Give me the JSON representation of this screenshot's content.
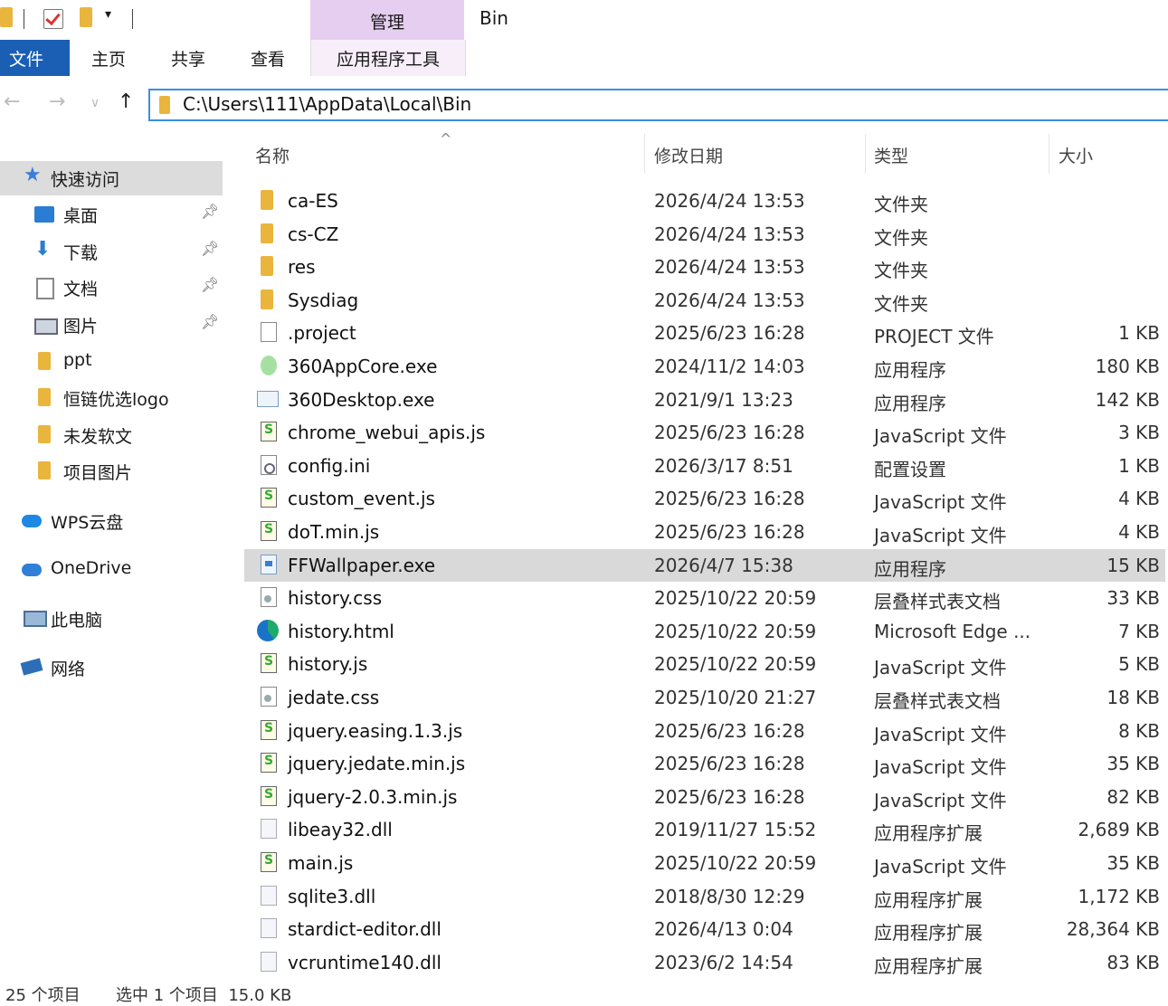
{
  "window": {
    "title": "Bin",
    "context_tab_group": "管理",
    "context_tab": "应用程序工具"
  },
  "ribbon": {
    "tabs": [
      "文件",
      "主页",
      "共享",
      "查看"
    ]
  },
  "address": {
    "path": "C:\\Users\\111\\AppData\\Local\\Bin"
  },
  "sidebar": {
    "quick_access": "快速访问",
    "items": [
      {
        "label": "桌面",
        "icon": "desktop-icon",
        "pinned": true
      },
      {
        "label": "下载",
        "icon": "download-icon",
        "pinned": true
      },
      {
        "label": "文档",
        "icon": "document-icon",
        "pinned": true
      },
      {
        "label": "图片",
        "icon": "picture-icon",
        "pinned": true
      },
      {
        "label": "ppt",
        "icon": "folder-icon",
        "pinned": false
      },
      {
        "label": "恒链优选logo",
        "icon": "folder-icon",
        "pinned": false
      },
      {
        "label": "未发软文",
        "icon": "folder-icon",
        "pinned": false
      },
      {
        "label": "项目图片",
        "icon": "folder-icon",
        "pinned": false
      }
    ],
    "locations": [
      {
        "label": "WPS云盘",
        "icon": "wps-cloud-icon"
      },
      {
        "label": "OneDrive",
        "icon": "onedrive-icon"
      },
      {
        "label": "此电脑",
        "icon": "this-pc-icon"
      },
      {
        "label": "网络",
        "icon": "network-icon"
      }
    ]
  },
  "columns": {
    "name": "名称",
    "date": "修改日期",
    "type": "类型",
    "size": "大小"
  },
  "files": [
    {
      "name": "ca-ES",
      "date": "2026/4/24 13:53",
      "type": "文件夹",
      "size": "",
      "icon": "folder-icon"
    },
    {
      "name": "cs-CZ",
      "date": "2026/4/24 13:53",
      "type": "文件夹",
      "size": "",
      "icon": "folder-icon"
    },
    {
      "name": "res",
      "date": "2026/4/24 13:53",
      "type": "文件夹",
      "size": "",
      "icon": "folder-icon"
    },
    {
      "name": "Sysdiag",
      "date": "2026/4/24 13:53",
      "type": "文件夹",
      "size": "",
      "icon": "folder-icon"
    },
    {
      "name": ".project",
      "date": "2025/6/23 16:28",
      "type": "PROJECT 文件",
      "size": "1 KB",
      "icon": "blank-file-icon"
    },
    {
      "name": "360AppCore.exe",
      "date": "2024/11/2 14:03",
      "type": "应用程序",
      "size": "180 KB",
      "icon": "360-app-icon"
    },
    {
      "name": "360Desktop.exe",
      "date": "2021/9/1 13:23",
      "type": "应用程序",
      "size": "142 KB",
      "icon": "exe-window-icon"
    },
    {
      "name": "chrome_webui_apis.js",
      "date": "2025/6/23 16:28",
      "type": "JavaScript 文件",
      "size": "3 KB",
      "icon": "js-file-icon"
    },
    {
      "name": "config.ini",
      "date": "2026/3/17 8:51",
      "type": "配置设置",
      "size": "1 KB",
      "icon": "ini-file-icon"
    },
    {
      "name": "custom_event.js",
      "date": "2025/6/23 16:28",
      "type": "JavaScript 文件",
      "size": "4 KB",
      "icon": "js-file-icon"
    },
    {
      "name": "doT.min.js",
      "date": "2025/6/23 16:28",
      "type": "JavaScript 文件",
      "size": "4 KB",
      "icon": "js-file-icon"
    },
    {
      "name": "FFWallpaper.exe",
      "date": "2026/4/7 15:38",
      "type": "应用程序",
      "size": "15 KB",
      "icon": "exe-app-icon",
      "selected": true
    },
    {
      "name": "history.css",
      "date": "2025/10/22 20:59",
      "type": "层叠样式表文档",
      "size": "33 KB",
      "icon": "css-file-icon"
    },
    {
      "name": "history.html",
      "date": "2025/10/22 20:59",
      "type": "Microsoft Edge ...",
      "size": "7 KB",
      "icon": "edge-icon"
    },
    {
      "name": "history.js",
      "date": "2025/10/22 20:59",
      "type": "JavaScript 文件",
      "size": "5 KB",
      "icon": "js-file-icon"
    },
    {
      "name": "jedate.css",
      "date": "2025/10/20 21:27",
      "type": "层叠样式表文档",
      "size": "18 KB",
      "icon": "css-file-icon"
    },
    {
      "name": "jquery.easing.1.3.js",
      "date": "2025/6/23 16:28",
      "type": "JavaScript 文件",
      "size": "8 KB",
      "icon": "js-file-icon"
    },
    {
      "name": "jquery.jedate.min.js",
      "date": "2025/6/23 16:28",
      "type": "JavaScript 文件",
      "size": "35 KB",
      "icon": "js-file-icon"
    },
    {
      "name": "jquery-2.0.3.min.js",
      "date": "2025/6/23 16:28",
      "type": "JavaScript 文件",
      "size": "82 KB",
      "icon": "js-file-icon"
    },
    {
      "name": "libeay32.dll",
      "date": "2019/11/27 15:52",
      "type": "应用程序扩展",
      "size": "2,689 KB",
      "icon": "dll-file-icon"
    },
    {
      "name": "main.js",
      "date": "2025/10/22 20:59",
      "type": "JavaScript 文件",
      "size": "35 KB",
      "icon": "js-file-icon"
    },
    {
      "name": "sqlite3.dll",
      "date": "2018/8/30 12:29",
      "type": "应用程序扩展",
      "size": "1,172 KB",
      "icon": "dll-file-icon"
    },
    {
      "name": "stardict-editor.dll",
      "date": "2026/4/13 0:04",
      "type": "应用程序扩展",
      "size": "28,364 KB",
      "icon": "dll-file-icon"
    },
    {
      "name": "vcruntime140.dll",
      "date": "2023/6/2 14:54",
      "type": "应用程序扩展",
      "size": "83 KB",
      "icon": "dll-file-icon"
    }
  ],
  "status": {
    "item_count": "25 个项目",
    "selection": "选中 1 个项目  15.0 KB"
  },
  "colors": {
    "file_tab": "#1a5fb4",
    "context_tab": "#e6cef0",
    "selection": "#d9d9d9",
    "address_border": "#3a8ee6",
    "folder": "#e9b53c"
  }
}
